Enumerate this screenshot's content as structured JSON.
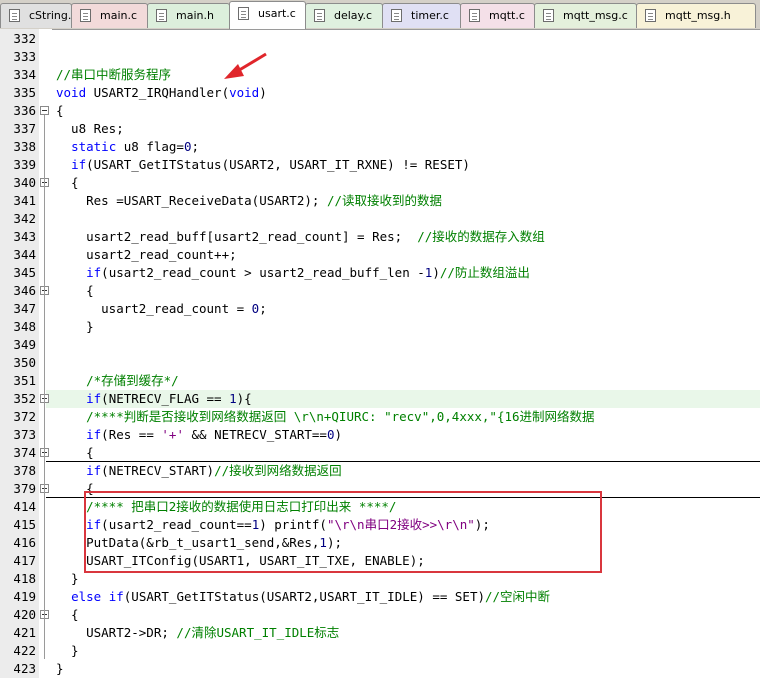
{
  "tabs": [
    {
      "label": "cString.c",
      "active": false,
      "color": "#e0e0e0"
    },
    {
      "label": "main.c",
      "active": false,
      "color": "#f2dada"
    },
    {
      "label": "main.h",
      "active": false,
      "color": "#dcefdc"
    },
    {
      "label": "usart.c",
      "active": true,
      "color": "#ffffff"
    },
    {
      "label": "delay.c",
      "active": false,
      "color": "#dff0df"
    },
    {
      "label": "timer.c",
      "active": false,
      "color": "#e0e0f4"
    },
    {
      "label": "mqtt.c",
      "active": false,
      "color": "#f4e0e8"
    },
    {
      "label": "mqtt_msg.c",
      "active": false,
      "color": "#e4f0dc"
    },
    {
      "label": "mqtt_msg.h",
      "active": false,
      "color": "#f8f2d8"
    }
  ],
  "lines": [
    {
      "n": "332",
      "t": ""
    },
    {
      "n": "333",
      "t": ""
    },
    {
      "n": "334",
      "t": "//串口中断服务程序"
    },
    {
      "n": "335",
      "t": "void USART2_IRQHandler(void)"
    },
    {
      "n": "336",
      "t": "{"
    },
    {
      "n": "337",
      "t": "  u8 Res;"
    },
    {
      "n": "338",
      "t": "  static u8 flag=0;"
    },
    {
      "n": "339",
      "t": "  if(USART_GetITStatus(USART2, USART_IT_RXNE) != RESET)"
    },
    {
      "n": "340",
      "t": "  {"
    },
    {
      "n": "341",
      "t": "    Res =USART_ReceiveData(USART2); //读取接收到的数据"
    },
    {
      "n": "342",
      "t": ""
    },
    {
      "n": "343",
      "t": "    usart2_read_buff[usart2_read_count] = Res;  //接收的数据存入数组"
    },
    {
      "n": "344",
      "t": "    usart2_read_count++;"
    },
    {
      "n": "345",
      "t": "    if(usart2_read_count > usart2_read_buff_len -1)//防止数组溢出"
    },
    {
      "n": "346",
      "t": "    {"
    },
    {
      "n": "347",
      "t": "      usart2_read_count = 0;"
    },
    {
      "n": "348",
      "t": "    }"
    },
    {
      "n": "349",
      "t": ""
    },
    {
      "n": "350",
      "t": ""
    },
    {
      "n": "351",
      "t": "    /*存储到缓存*/"
    },
    {
      "n": "352",
      "t": "    if(NETRECV_FLAG == 1){"
    },
    {
      "n": "372",
      "t": "    /****判断是否接收到网络数据返回 \\r\\n+QIURC: \"recv\",0,4xxx,\"{16进制网络数据"
    },
    {
      "n": "373",
      "t": "    if(Res == '+' && NETRECV_START==0)"
    },
    {
      "n": "374",
      "t": "    {"
    },
    {
      "n": "378",
      "t": "    if(NETRECV_START)//接收到网络数据返回"
    },
    {
      "n": "379",
      "t": "    {"
    },
    {
      "n": "414",
      "t": "    /**** 把串口2接收的数据使用日志口打印出来 ****/"
    },
    {
      "n": "415",
      "t": "    if(usart2_read_count==1) printf(\"\\r\\n串口2接收>>\\r\\n\");"
    },
    {
      "n": "416",
      "t": "    PutData(&rb_t_usart1_send,&Res,1);"
    },
    {
      "n": "417",
      "t": "    USART_ITConfig(USART1, USART_IT_TXE, ENABLE);"
    },
    {
      "n": "418",
      "t": "  }"
    },
    {
      "n": "419",
      "t": "  else if(USART_GetITStatus(USART2,USART_IT_IDLE) == SET)//空闲中断"
    },
    {
      "n": "420",
      "t": "  {"
    },
    {
      "n": "421",
      "t": "    USART2->DR; //清除USART_IT_IDLE标志"
    },
    {
      "n": "422",
      "t": "  }"
    },
    {
      "n": "423",
      "t": "}"
    }
  ],
  "colors": {
    "keyword": "#0000ff",
    "comment": "#008000",
    "string": "#800080",
    "number": "#000080",
    "highlight_box": "#d9363e"
  },
  "icons": [
    "file-icon",
    "fold-minus-icon",
    "fold-plus-icon",
    "red-arrow-icon"
  ]
}
